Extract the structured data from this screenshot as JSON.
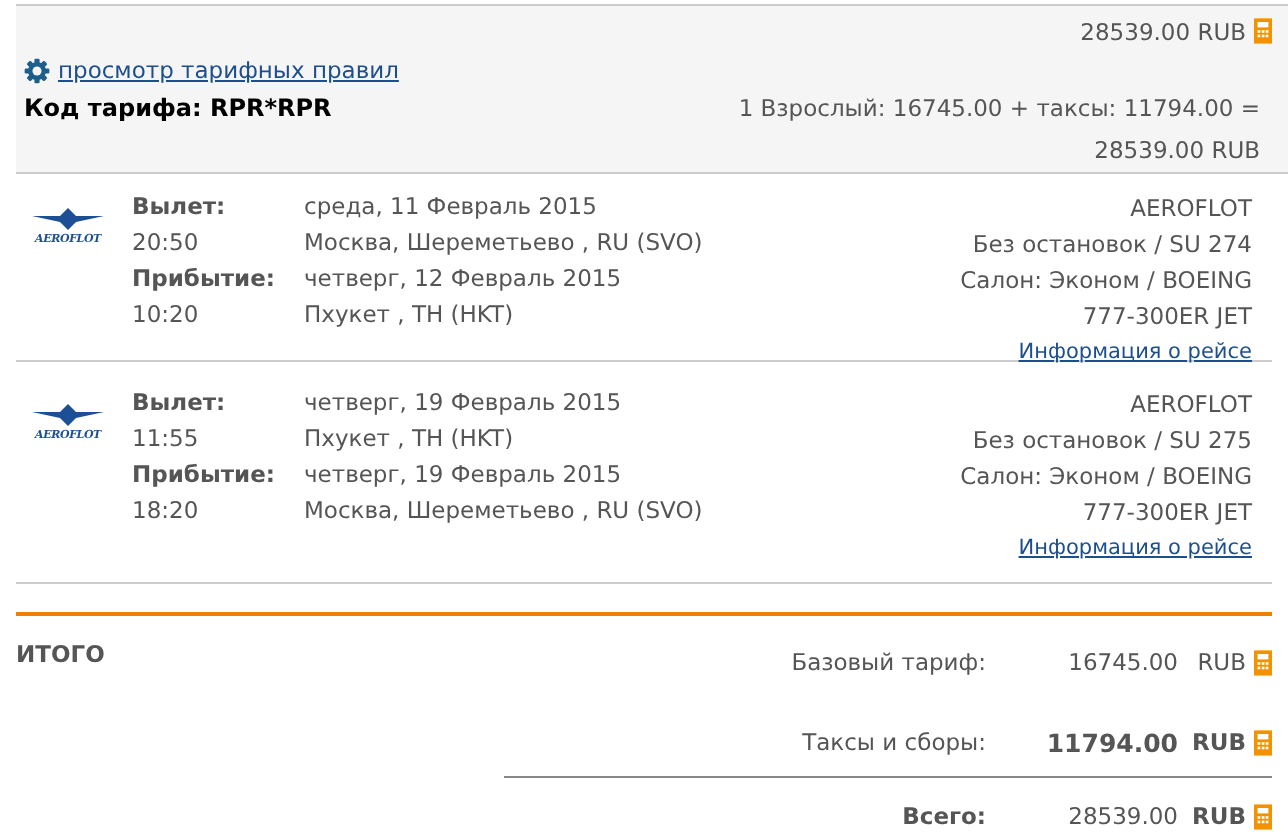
{
  "fare": {
    "top_total": "28539.00 RUB",
    "rules_link": "просмотр тарифных правил",
    "fare_code": "Код тарифа: RPR*RPR",
    "breakdown": "1 Взрослый: 16745.00 + таксы: 11794.00 =",
    "breakdown_total": "28539.00 RUB"
  },
  "segments": [
    {
      "logo_text": "AEROFLOT",
      "departure_label": "Вылет:",
      "departure_time": "20:50",
      "departure_date": "среда, 11 Февраль 2015",
      "departure_place": "Москва, Шереметьево , RU (SVO)",
      "arrival_label": "Прибытие:",
      "arrival_time": "10:20",
      "arrival_date": "четверг, 12 Февраль 2015",
      "arrival_place": "Пхукет , TH (HKT)",
      "airline": "AEROFLOT",
      "stops": "Без остановок / SU 274",
      "cabin": "Салон: Эконом / BOEING 777-300ER JET",
      "info_link": "Информация о рейсе"
    },
    {
      "logo_text": "AEROFLOT",
      "departure_label": "Вылет:",
      "departure_time": "11:55",
      "departure_date": "четверг, 19 Февраль 2015",
      "departure_place": "Пхукет , TH (HKT)",
      "arrival_label": "Прибытие:",
      "arrival_time": "18:20",
      "arrival_date": "четверг, 19 Февраль 2015",
      "arrival_place": "Москва, Шереметьево , RU (SVO)",
      "airline": "AEROFLOT",
      "stops": "Без остановок / SU 275",
      "cabin": "Салон: Эконом / BOEING 777-300ER JET",
      "info_link": "Информация о рейсе"
    }
  ],
  "totals": {
    "title": "ИТОГО",
    "rows": [
      {
        "label": "Базовый тариф:",
        "amount": "16745.00",
        "currency": "RUB",
        "label_bold": false,
        "amount_bold": false,
        "currency_bold": false
      },
      {
        "label": "Таксы и сборы:",
        "amount": "11794.00",
        "currency": "RUB",
        "label_bold": false,
        "amount_bold": true,
        "currency_bold": true
      },
      {
        "label": "Всего:",
        "amount": "28539.00",
        "currency": "RUB",
        "label_bold": true,
        "amount_bold": false,
        "currency_bold": true
      }
    ]
  }
}
